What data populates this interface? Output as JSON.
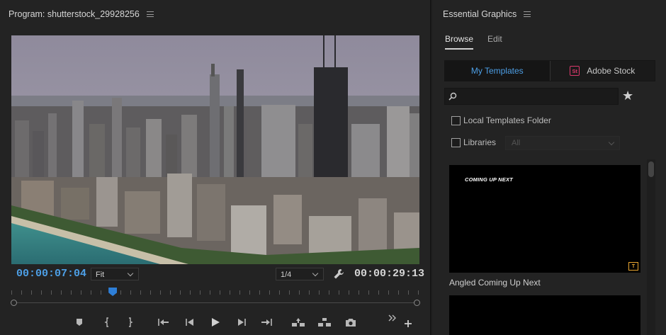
{
  "program": {
    "title": "Program: shutterstock_29928256",
    "timecode_current": "00:00:07:04",
    "timecode_duration": "00:00:29:13",
    "zoom_select": "Fit",
    "resolution_select": "1/4",
    "playhead_fraction": 0.245
  },
  "essential_graphics": {
    "title": "Essential Graphics",
    "tabs": [
      "Browse",
      "Edit"
    ],
    "active_tab": "Browse",
    "sources": [
      {
        "label": "My Templates",
        "active": true
      },
      {
        "label": "Adobe Stock",
        "badge": "St"
      }
    ],
    "search": {
      "value": "",
      "placeholder": ""
    },
    "local_templates_label": "Local Templates Folder",
    "libraries_label": "Libraries",
    "libraries_select": "All",
    "templates": [
      {
        "preview_text": "COMING UP NEXT",
        "name": "Angled Coming Up Next",
        "badge": "T"
      },
      {
        "preview_text": "",
        "name": ""
      }
    ]
  },
  "icons": [
    "menu-icon",
    "wrench-icon",
    "search-icon",
    "star-icon",
    "marker-icon",
    "mark-in-icon",
    "mark-out-icon",
    "go-to-in-icon",
    "step-back-icon",
    "play-icon",
    "step-forward-icon",
    "go-to-out-icon",
    "lift-icon",
    "extract-icon",
    "camera-icon",
    "more-icon",
    "add-icon"
  ],
  "colors": {
    "accent": "#4d9fe6",
    "stock": "#d9386b",
    "template_badge": "#e8a530"
  }
}
